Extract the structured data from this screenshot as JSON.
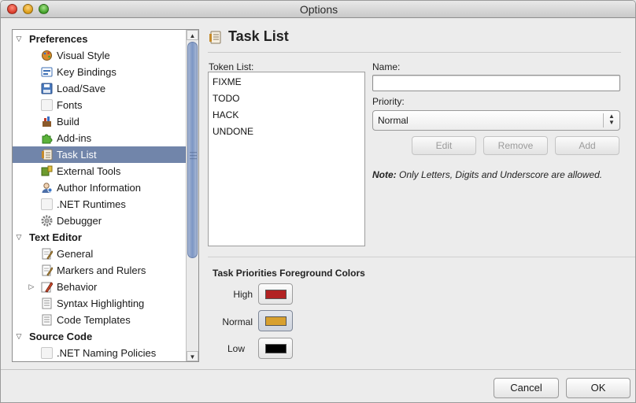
{
  "window": {
    "title": "Options"
  },
  "sidebar": {
    "rows": [
      {
        "type": "section",
        "label": "Preferences",
        "expanded": true
      },
      {
        "type": "item",
        "label": "Visual Style",
        "icon": "palette-icon",
        "color": "#d98b2a"
      },
      {
        "type": "item",
        "label": "Key Bindings",
        "icon": "keyboard-icon",
        "color": "#3d6fb5"
      },
      {
        "type": "item",
        "label": "Load/Save",
        "icon": "disk-icon",
        "color": "#4a7bc0"
      },
      {
        "type": "item",
        "label": "Fonts",
        "icon": "blank-icon",
        "color": ""
      },
      {
        "type": "item",
        "label": "Build",
        "icon": "build-icon",
        "color": "#8a5a2b"
      },
      {
        "type": "item",
        "label": "Add-ins",
        "icon": "puzzle-icon",
        "color": "#5bb23a"
      },
      {
        "type": "item",
        "label": "Task List",
        "icon": "tasklist-icon",
        "color": "#c58a2a",
        "selected": true
      },
      {
        "type": "item",
        "label": "External Tools",
        "icon": "tools-icon",
        "color": "#6c9a2e"
      },
      {
        "type": "item",
        "label": "Author Information",
        "icon": "person-icon",
        "color": "#4d6fa8"
      },
      {
        "type": "item",
        "label": ".NET Runtimes",
        "icon": "blank-icon",
        "color": ""
      },
      {
        "type": "item",
        "label": "Debugger",
        "icon": "gear-icon",
        "color": "#777777"
      },
      {
        "type": "section",
        "label": "Text Editor",
        "expanded": true
      },
      {
        "type": "item",
        "label": "General",
        "icon": "document-pencil-icon",
        "color": "#cfa85a"
      },
      {
        "type": "item",
        "label": "Markers and Rulers",
        "icon": "document-pencil-icon",
        "color": "#cfa85a"
      },
      {
        "type": "item",
        "label": "Behavior",
        "icon": "pencil-icon",
        "color": "#d4502f",
        "collapsed": true
      },
      {
        "type": "item",
        "label": "Syntax Highlighting",
        "icon": "document-lines-icon",
        "color": "#8c8c8c"
      },
      {
        "type": "item",
        "label": "Code Templates",
        "icon": "document-lines-icon",
        "color": "#8c8c8c"
      },
      {
        "type": "section",
        "label": "Source Code",
        "expanded": true
      },
      {
        "type": "item",
        "label": ".NET Naming Policies",
        "icon": "blank-icon",
        "color": ""
      }
    ]
  },
  "panel": {
    "title": "Task List",
    "token_list_label": "Token List:",
    "tokens": [
      "FIXME",
      "TODO",
      "HACK",
      "UNDONE"
    ],
    "name_label": "Name:",
    "name_value": "",
    "priority_label": "Priority:",
    "priority_value": "Normal",
    "edit_label": "Edit",
    "remove_label": "Remove",
    "add_label": "Add",
    "note_bold": "Note:",
    "note_text": " Only Letters, Digits and Underscore are allowed.",
    "colors_title": "Task Priorities Foreground Colors",
    "colors": [
      {
        "label": "High",
        "color": "#b22222"
      },
      {
        "label": "Normal",
        "color": "#d8a030"
      },
      {
        "label": "Low",
        "color": "#000000"
      }
    ]
  },
  "footer": {
    "cancel_label": "Cancel",
    "ok_label": "OK"
  }
}
